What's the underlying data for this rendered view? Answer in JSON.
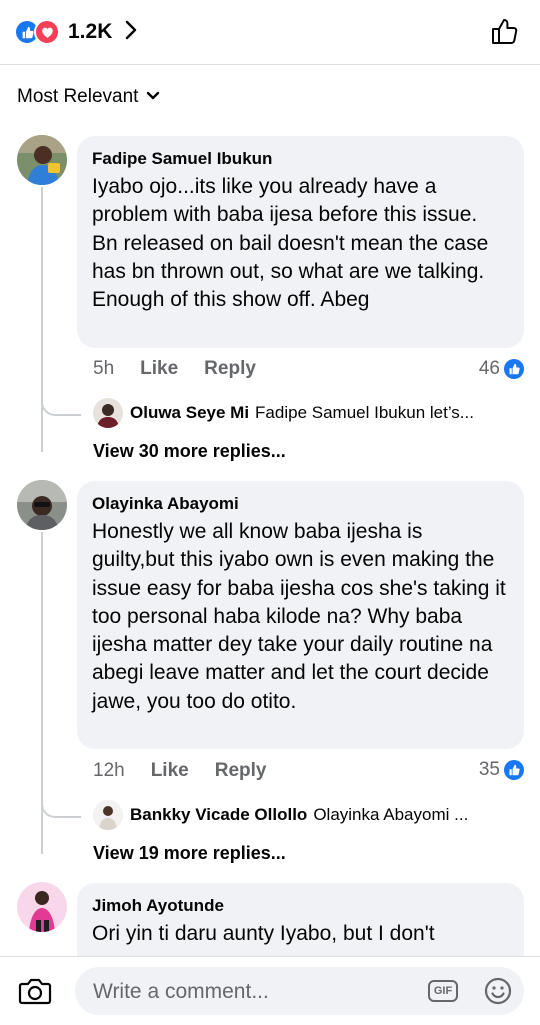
{
  "reactions": {
    "count": "1.2K",
    "types": [
      "like-icon",
      "love-icon"
    ],
    "like_color": "#1877f2",
    "love_color": "#f33e58"
  },
  "sort": {
    "label": "Most Relevant"
  },
  "comments": [
    {
      "author": "Fadipe Samuel Ibukun",
      "text": "Iyabo ojo...its like you already have a problem with baba ijesa before this issue.  Bn released on bail doesn't mean the case has bn thrown out, so what are we talking.  Enough of this show off. Abeg",
      "time": "5h",
      "like_label": "Like",
      "reply_label": "Reply",
      "reactions": "46",
      "reply_preview": {
        "author": "Oluwa Seye Mi",
        "text": "Fadipe Samuel Ibukun let’s..."
      },
      "view_more": "View 30 more replies..."
    },
    {
      "author": "Olayinka Abayomi",
      "text": "Honestly we all know baba ijesha is guilty,but this iyabo own is even making the issue easy for baba ijesha cos she's taking it too personal haba kilode na? Why baba ijesha matter dey take your daily routine na abegi leave matter and let the court decide jawe, you too do otito.",
      "time": "12h",
      "like_label": "Like",
      "reply_label": "Reply",
      "reactions": "35",
      "reply_preview": {
        "author": "Bankky Vicade Ollollo",
        "text": "Olayinka Abayomi ..."
      },
      "view_more": "View 19 more replies..."
    },
    {
      "author": "Jimoh Ayotunde",
      "text": "Ori yin ti daru aunty Iyabo, but I don't"
    }
  ],
  "composer": {
    "placeholder": "Write a comment...",
    "gif_label": "GIF"
  }
}
